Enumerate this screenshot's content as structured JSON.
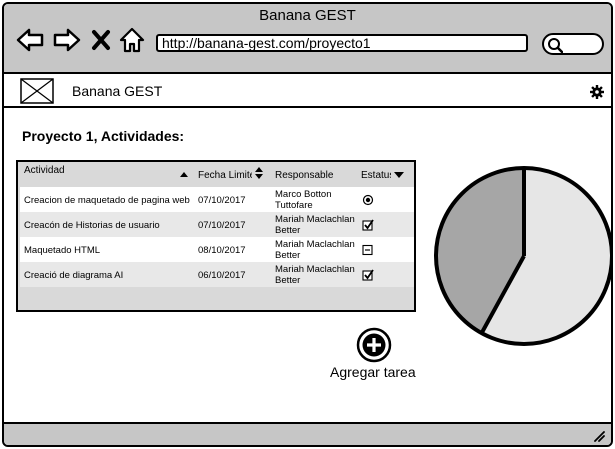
{
  "window": {
    "title": "Banana GEST"
  },
  "browser": {
    "url": "http://banana-gest.com/proyecto1",
    "icons": [
      "back-arrow-icon",
      "forward-arrow-icon",
      "close-x-icon",
      "home-icon",
      "search-icon"
    ]
  },
  "app": {
    "name": "Banana GEST",
    "logo_icon": "image-placeholder-icon",
    "settings_icon": "gear-icon"
  },
  "page": {
    "title": "Proyecto 1, Actividades:"
  },
  "table": {
    "headers": {
      "activity": "Actividad",
      "deadline": "Fecha Limite",
      "responsible": "Responsable",
      "status": "Estatus"
    },
    "rows": [
      {
        "activity": "Creacion de maquetado de pagina web",
        "deadline": "07/10/2017",
        "responsible_l1": "Marco Botton",
        "responsible_l2": "Tuttofare",
        "status": "radio-selected"
      },
      {
        "activity": "Creacón de Historias de usuario",
        "deadline": "07/10/2017",
        "responsible_l1": "Mariah Maclachlan",
        "responsible_l2": "Better",
        "status": "checked"
      },
      {
        "activity": "Maquetado HTML",
        "deadline": "08/10/2017",
        "responsible_l1": "Mariah Maclachlan",
        "responsible_l2": "Better",
        "status": "indeterminate"
      },
      {
        "activity": "Creació de diagrama AI",
        "deadline": "06/10/2017",
        "responsible_l1": "Mariah Maclachlan",
        "responsible_l2": "Better",
        "status": "checked"
      }
    ]
  },
  "actions": {
    "add_task_label": "Agregar tarea",
    "add_icon": "plus-circle-icon"
  },
  "chart": {
    "slices": [
      0.42,
      0.58
    ],
    "colors": [
      "#a6a6a6",
      "#e6e6e6"
    ]
  }
}
